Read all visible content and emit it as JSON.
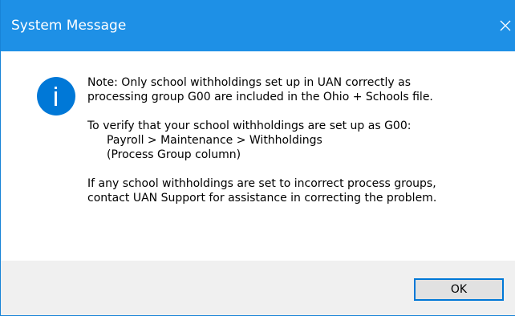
{
  "window": {
    "title": "System Message",
    "close_icon": "close-icon",
    "accent_color": "#1e90e6"
  },
  "message": {
    "icon": "info-icon",
    "icon_color": "#0078d7",
    "line1": "Note: Only school withholdings set up in UAN correctly as",
    "line2": "processing group G00 are included in the Ohio + Schools file.",
    "line3": "To verify that your school withholdings are set up as G00:",
    "line4": "Payroll > Maintenance > Withholdings",
    "line5": "(Process Group column)",
    "line6": "If any school withholdings are set to incorrect process groups,",
    "line7": "contact UAN Support for assistance in correcting the problem."
  },
  "buttons": {
    "ok_label": "OK"
  }
}
